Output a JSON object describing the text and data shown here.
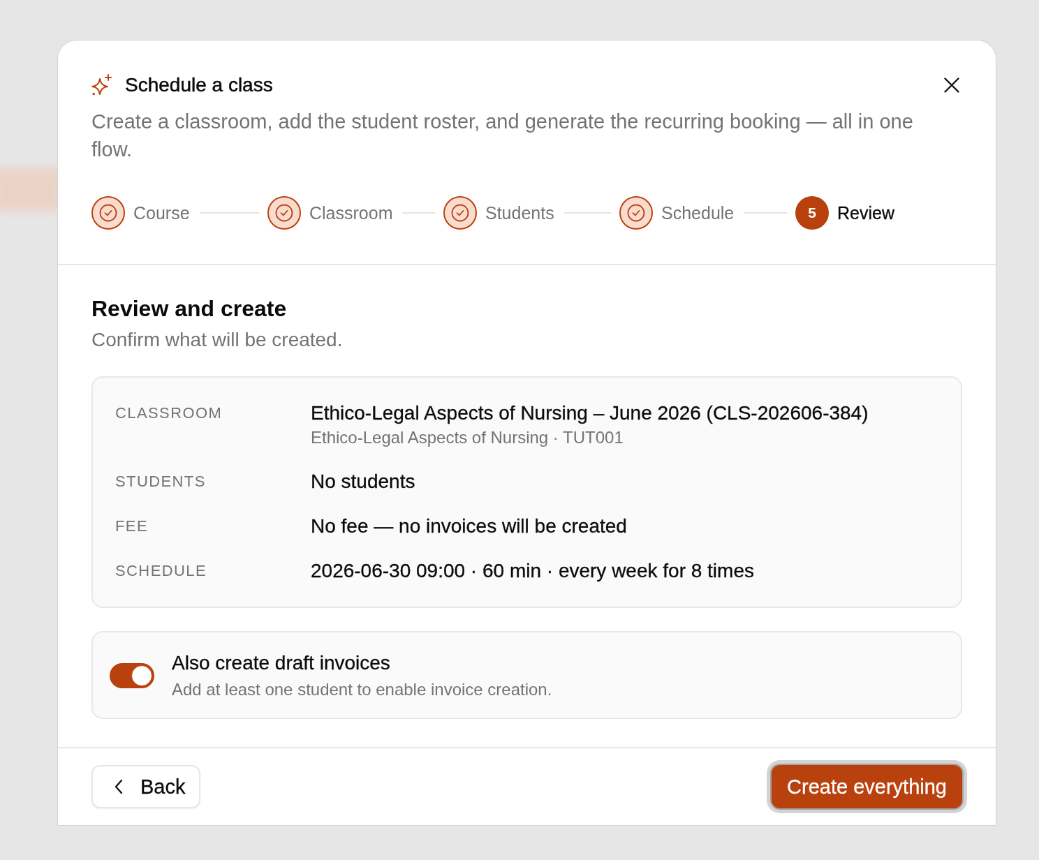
{
  "dialog": {
    "title": "Schedule a class",
    "description": "Create a classroom, add the student roster, and generate the recurring booking — all in one flow."
  },
  "steps": [
    {
      "label": "Course",
      "completed": true,
      "selected": false
    },
    {
      "label": "Classroom",
      "completed": true,
      "selected": false
    },
    {
      "label": "Students",
      "completed": true,
      "selected": false
    },
    {
      "label": "Schedule",
      "completed": true,
      "selected": false
    },
    {
      "label": "Review",
      "number": "5",
      "completed": false,
      "selected": true
    }
  ],
  "review": {
    "heading": "Review and create",
    "subheading": "Confirm what will be created."
  },
  "summary": {
    "rows": [
      {
        "label": "CLASSROOM",
        "value": "Ethico-Legal Aspects of Nursing – June 2026 (CLS-202606-384)",
        "detail": "Ethico-Legal Aspects of Nursing · TUT001"
      },
      {
        "label": "STUDENTS",
        "value": "No students"
      },
      {
        "label": "FEE",
        "value": "No fee — no invoices will be created"
      },
      {
        "label": "SCHEDULE",
        "value": "2026-06-30 09:00 · 60 min · every week for 8 times"
      }
    ]
  },
  "invoice_option": {
    "title": "Also create draft invoices",
    "hint": "Add at least one student to enable invoice creation.",
    "on": true
  },
  "footer": {
    "back_button": {
      "label": "Back"
    },
    "create_button": {
      "label": "Create everything",
      "focused": true
    }
  }
}
